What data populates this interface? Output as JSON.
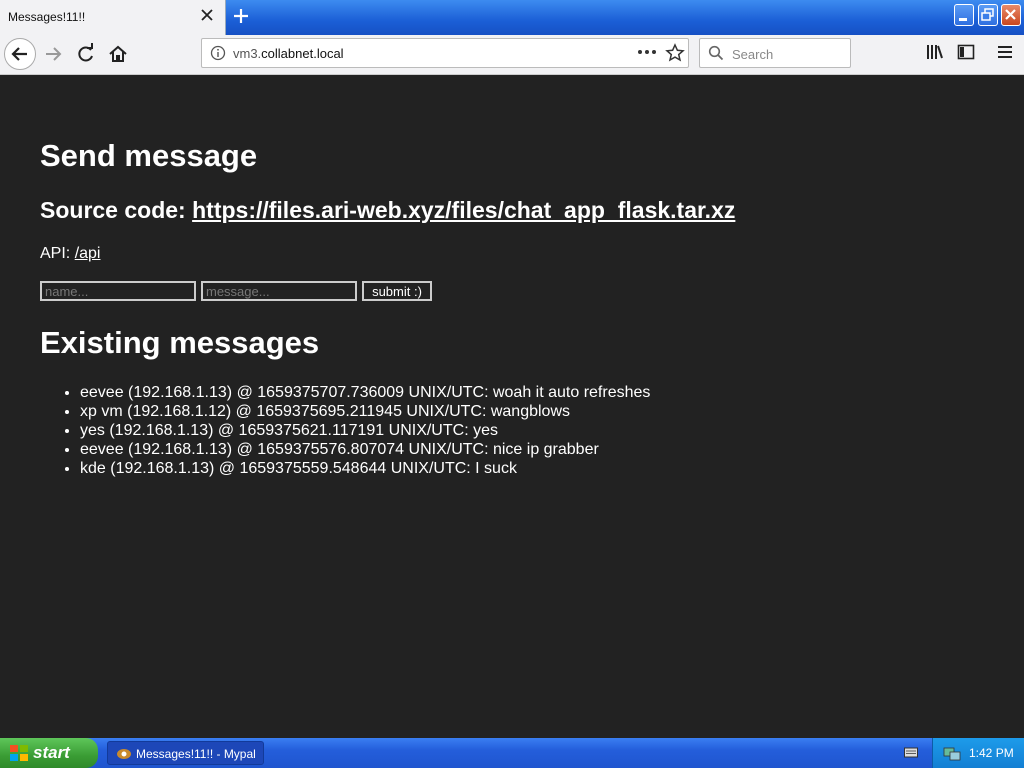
{
  "browser": {
    "tab_title": "Messages!11!!",
    "url_prefix": "vm3.",
    "url_domain": "collabnet.local",
    "search_placeholder": "Search"
  },
  "page": {
    "heading": "Send message",
    "source_label": "Source code: ",
    "source_link": "https://files.ari-web.xyz/files/chat_app_flask.tar.xz",
    "api_label": "API: ",
    "api_link": "/api",
    "name_placeholder": "name...",
    "message_placeholder": "message...",
    "submit_label": "submit :)",
    "existing_heading": "Existing messages",
    "messages": [
      "eevee (192.168.1.13) @ 1659375707.736009 UNIX/UTC: woah it auto refreshes",
      "xp vm (192.168.1.12) @ 1659375695.211945 UNIX/UTC: wangblows",
      "yes (192.168.1.13) @ 1659375621.117191 UNIX/UTC: yes",
      "eevee (192.168.1.13) @ 1659375576.807074 UNIX/UTC: nice ip grabber",
      "kde (192.168.1.13) @ 1659375559.548644 UNIX/UTC: I suck"
    ]
  },
  "taskbar": {
    "start_label": "start",
    "task_label": "Messages!11!! - Mypal",
    "clock": "1:42 PM"
  },
  "icons": [
    "close-icon",
    "plus-icon",
    "back-arrow-icon",
    "forward-arrow-icon",
    "reload-icon",
    "home-icon",
    "info-icon",
    "more-icon",
    "star-icon",
    "search-icon",
    "library-icon",
    "sidebar-icon",
    "menu-icon",
    "windows-logo-icon",
    "browser-icon",
    "keyboard-icon",
    "network-icon"
  ]
}
